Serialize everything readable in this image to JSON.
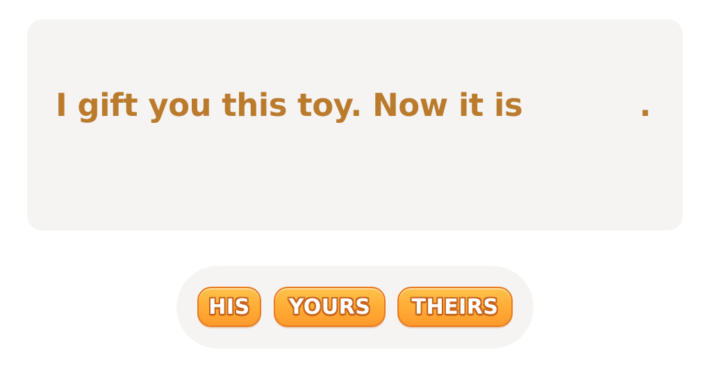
{
  "sentence": {
    "before_blank": "I gift you this toy. Now it is",
    "after_blank": "."
  },
  "choices": [
    {
      "label": "HIS"
    },
    {
      "label": "YOURS"
    },
    {
      "label": "THEIRS"
    }
  ],
  "colors": {
    "sentence_text": "#bb7b2d",
    "card_background": "#f5f4f3",
    "button_fill": "#ffab35",
    "button_border": "#e8781e"
  }
}
